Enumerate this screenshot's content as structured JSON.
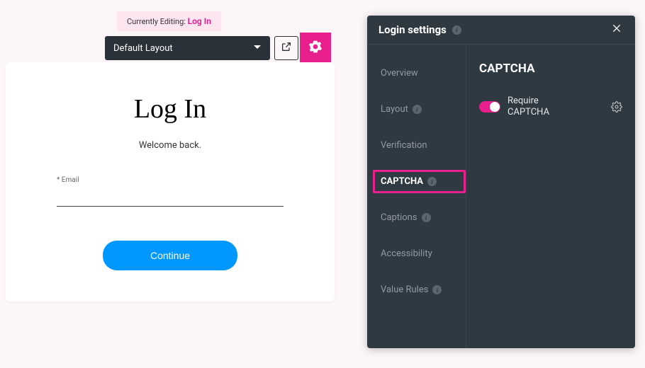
{
  "editor": {
    "currently_editing_prefix": "Currently Editing:",
    "currently_editing_name": "Log In",
    "layout_select": "Default Layout"
  },
  "form": {
    "title": "Log In",
    "subtitle": "Welcome back.",
    "email_label": "* Email",
    "email_value": "",
    "continue_label": "Continue"
  },
  "panel": {
    "title": "Login settings",
    "nav": {
      "overview": "Overview",
      "layout": "Layout",
      "verification": "Verification",
      "captcha": "CAPTCHA",
      "captions": "Captions",
      "accessibility": "Accessibility",
      "value_rules": "Value Rules"
    },
    "section_title": "CAPTCHA",
    "require_captcha_label": "Require CAPTCHA"
  },
  "colors": {
    "accent": "#e81f8c",
    "panel_bg": "#2e3942",
    "primary_btn": "#0098ff"
  }
}
